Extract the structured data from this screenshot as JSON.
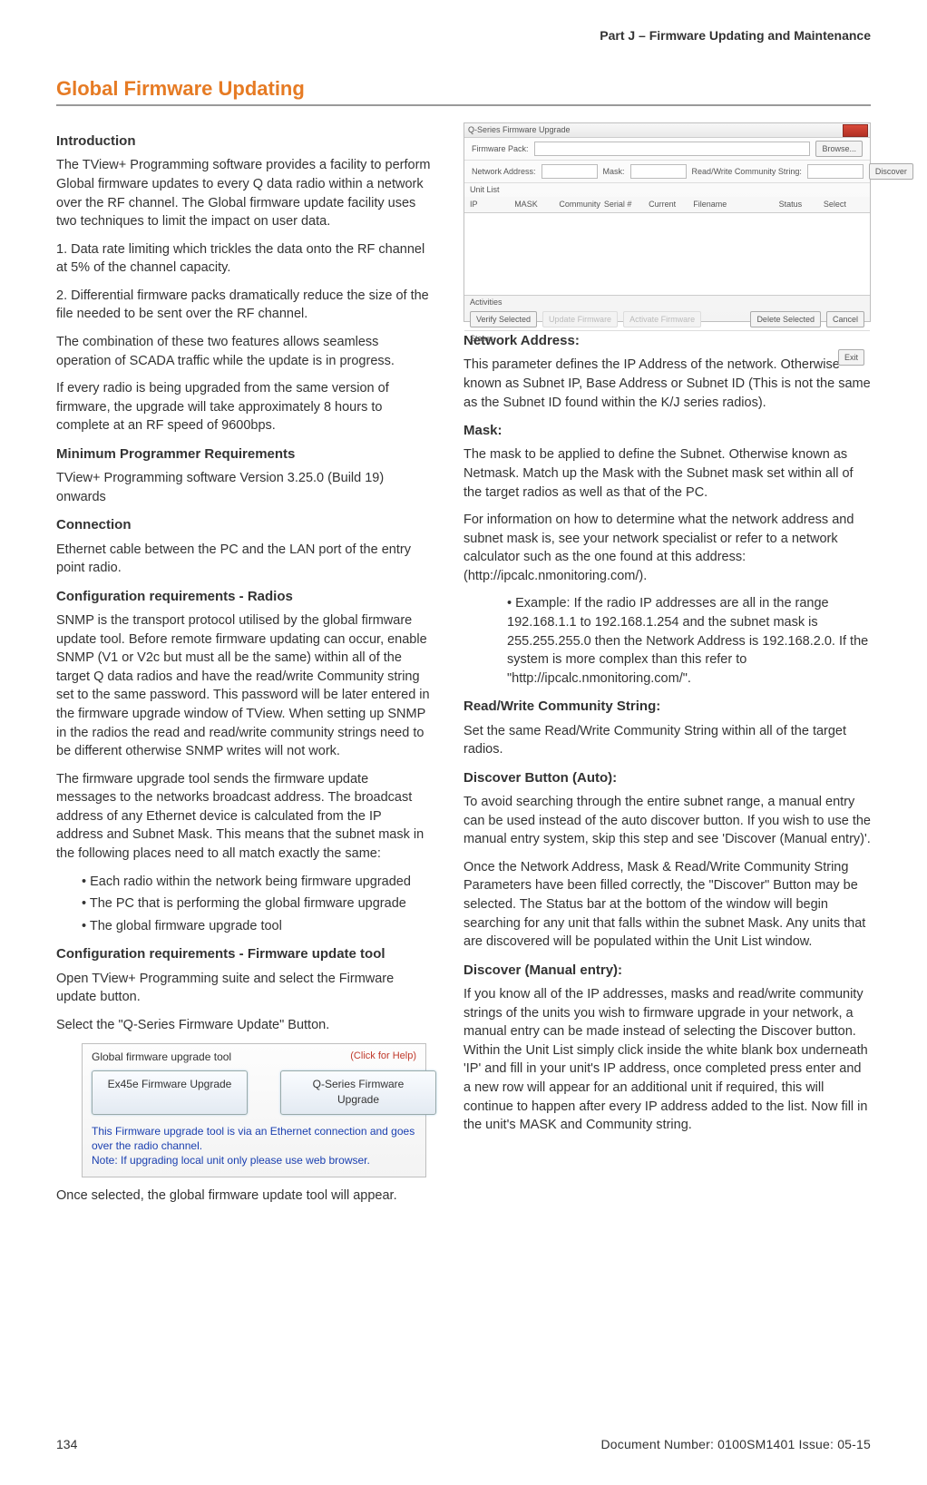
{
  "running_head": "Part J – Firmware Updating and Maintenance",
  "section_title": "Global Firmware Updating",
  "col1": {
    "h_intro": "Introduction",
    "p_intro1": "The TView+ Programming software provides a facility to perform Global firmware updates to every Q data radio within a network over the RF channel. The Global firmware update facility uses two techniques to limit the impact on user data.",
    "p_intro2": "1. Data rate limiting which trickles the data onto the RF channel at 5% of the channel capacity.",
    "p_intro3": "2. Differential firmware packs dramatically reduce the size of the file needed to be sent over the RF channel.",
    "p_intro4": "The combination of these two features allows seamless operation of SCADA traffic while the update is in progress.",
    "p_intro5": "If every radio is being upgraded from the same version of firmware, the upgrade will take approximately 8 hours to complete at an RF speed of 9600bps.",
    "h_minreq": "Minimum Programmer Requirements",
    "p_minreq": "TView+ Programming software Version 3.25.0 (Build 19) onwards",
    "h_conn": "Connection",
    "p_conn": "Ethernet cable between the PC and the LAN port of the entry point radio.",
    "h_cfg_radio": "Configuration requirements - Radios",
    "p_cfg_radio1": "SNMP is the transport protocol utilised by the global firmware update tool. Before remote firmware updating can occur, enable SNMP (V1 or V2c but must all be the same) within all of the target Q data radios and have the read/write Community string set to the same password. This password will be later entered in the firmware upgrade window of TView. When setting up SNMP in the radios the read and read/write community strings need to be different otherwise SNMP writes will not work.",
    "p_cfg_radio2": "The firmware upgrade tool sends the firmware update messages to the networks broadcast address. The broadcast address of any Ethernet device is calculated from the IP address and Subnet Mask. This means that the subnet mask in the following places need to all match exactly the same:",
    "bullets": {
      "b1": "• Each radio within the network being firmware upgraded",
      "b2": "• The PC that is performing the global firmware upgrade",
      "b3": "• The global firmware upgrade tool"
    },
    "h_cfg_tool": "Configuration requirements - Firmware update tool",
    "p_cfg_tool1": "Open TView+ Programming suite and select the Firmware update button.",
    "p_cfg_tool2": "Select the \"Q-Series Firmware Update\" Button.",
    "p_cfg_tool3": "Once selected, the global firmware update tool will appear."
  },
  "shot2": {
    "title": "Global firmware upgrade tool",
    "help": "(Click for Help)",
    "btn1": "Ex45e Firmware Upgrade",
    "btn2": "Q-Series Firmware Upgrade",
    "note1": "This Firmware upgrade tool is via an Ethernet connection and goes over the radio channel.",
    "note2": "Note: If upgrading local unit only please use web browser."
  },
  "shot1": {
    "title": "Q-Series Firmware Upgrade",
    "pack_lbl": "Firmware Pack:",
    "browse": "Browse...",
    "netaddr": "Network Address:",
    "mask": "Mask:",
    "rwcomm": "Read/Write Community String:",
    "discover": "Discover",
    "list_lbl": "Unit List",
    "cols": {
      "ip": "IP",
      "mask": "MASK",
      "comm": "Community",
      "serial": "Serial #",
      "current": "Current",
      "filename": "Filename",
      "status": "Status",
      "select": "Select"
    },
    "bottom_lbl": "Activities",
    "verify": "Verify Selected",
    "upfw": "Update Firmware",
    "activate": "Activate Firmware",
    "delsel": "Delete Selected",
    "cancel": "Cancel",
    "status": "Status",
    "exit": "Exit"
  },
  "col2": {
    "h_netaddr": "Network Address:",
    "p_netaddr": "This parameter defines the IP Address of the network. Otherwise known as Subnet IP, Base Address or Subnet ID (This is not the same as the Subnet ID found within the K/J series radios).",
    "h_mask": "Mask:",
    "p_mask1": "The mask to be applied to define the Subnet. Otherwise known as Netmask. Match up the Mask with the Subnet mask set within all of the target radios as well as that of the PC.",
    "p_mask2": "For information on how to determine what the network address and subnet mask is, see your network specialist or refer to a network calculator such as the one found at this address: (http://ipcalc.nmonitoring.com/).",
    "example": "• Example: If the radio IP addresses are all in the range 192.168.1.1 to 192.168.1.254 and the subnet mask is 255.255.255.0 then the Network Address is 192.168.2.0. If the system is more complex than this refer to \"http://ipcalc.nmonitoring.com/\".",
    "h_rwcomm": "Read/Write Community String:",
    "p_rwcomm": "Set the same Read/Write Community String within all of the target radios.",
    "h_disc_auto": "Discover Button (Auto):",
    "p_disc_auto1": "To avoid searching through the entire subnet range, a manual entry can be used instead of the auto discover button. If you wish to use the manual entry system, skip this step and see 'Discover (Manual entry)'.",
    "p_disc_auto2": "Once the Network Address, Mask & Read/Write Community String Parameters have been filled correctly, the \"Discover\" Button may be selected. The Status bar at the bottom of the window will begin searching for any unit that falls within the subnet Mask. Any units that are discovered will be populated within the Unit List window.",
    "h_disc_man": "Discover (Manual entry):",
    "p_disc_man": "If you know all of the IP addresses, masks and read/write community strings of the units you wish to firmware upgrade in your network, a manual entry can be made instead of selecting the Discover button. Within the Unit List simply click inside the white blank box underneath 'IP' and fill in your unit's IP address, once completed press enter and a new row will appear for an additional unit if required, this will continue to happen after every IP address added to the list. Now fill in the unit's MASK and Community string."
  },
  "footer": {
    "page": "134",
    "doc": "Document Number: 0100SM1401   Issue: 05-15"
  }
}
